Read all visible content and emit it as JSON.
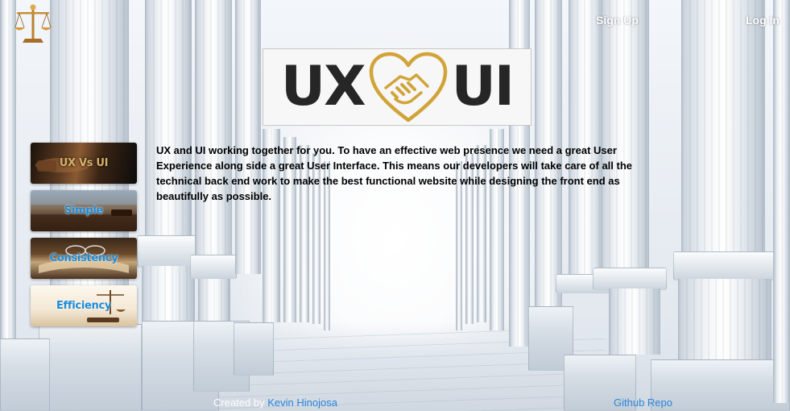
{
  "header": {
    "logo_icon": "scales-of-justice-icon",
    "nav": {
      "signup_label": "Sign Up",
      "login_label": "Log In"
    }
  },
  "hero": {
    "logo_left": "UX",
    "logo_icon": "handshake-heart-icon",
    "logo_right": "UI",
    "accent_color": "#d1a43a"
  },
  "intro": {
    "text": "UX and UI working together for you. To have an effective web presence we need a great User Experience along side a great User Interface. This means our developers will take care of all the technical back end work to make the best functional website while designing the front end as beautifully as possible."
  },
  "sidebar": {
    "items": [
      {
        "label": "UX Vs UI"
      },
      {
        "label": "Simple"
      },
      {
        "label": "Consistency"
      },
      {
        "label": "Efficiency"
      }
    ]
  },
  "footer": {
    "credit_prefix": "Created by",
    "author": "Kevin Hinojosa",
    "repo_label": "Github Repo",
    "link_color": "#2a86d9"
  }
}
